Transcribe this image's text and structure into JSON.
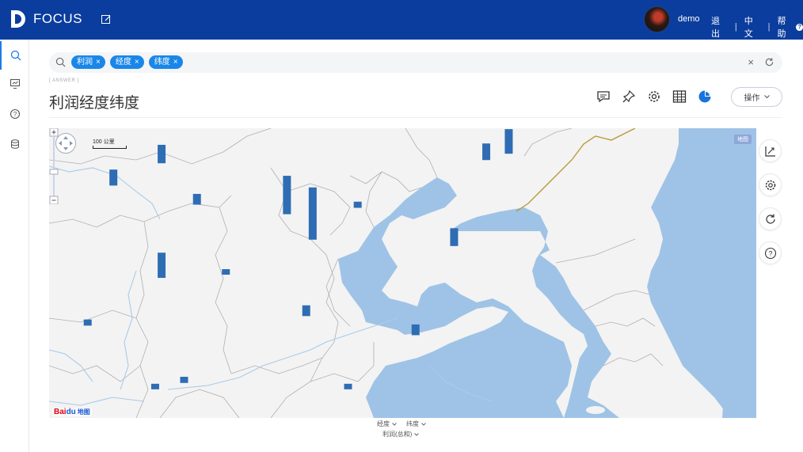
{
  "header": {
    "logo_text": "FOCUS",
    "user": "demo",
    "links": [
      "退出",
      "中文",
      "帮助"
    ]
  },
  "search": {
    "tags": [
      "利润",
      "经度",
      "纬度"
    ],
    "tag_close": "×",
    "clear_symbol": "×"
  },
  "answer_label": "[ ANSWER ]",
  "title": "利润经度纬度",
  "toolbar": {
    "icons": [
      "comment-icon",
      "pin-icon",
      "gear-icon",
      "table-icon",
      "pie-chart-icon"
    ],
    "operate_label": "操作"
  },
  "map": {
    "scale_label": "100 公里",
    "maptype_label": "地图",
    "logo_bai": "Bai",
    "logo_du": "du",
    "logo_map": "地图",
    "land_color": "#f3f3f3",
    "sea_color": "#9fc3e6",
    "bar_color": "#2e6db4",
    "border_color": "#b0b0b0",
    "korea_border_color": "#b8962e"
  },
  "chart_data": {
    "type": "bar",
    "title": "",
    "bars": [
      {
        "lng": 111.0,
        "lat": 40.8,
        "profit": 5200
      },
      {
        "lng": 112.5,
        "lat": 41.5,
        "profit": 6000
      },
      {
        "lng": 113.6,
        "lat": 40.2,
        "profit": 3500
      },
      {
        "lng": 116.4,
        "lat": 39.9,
        "profit": 12500
      },
      {
        "lng": 117.2,
        "lat": 39.1,
        "profit": 17000
      },
      {
        "lng": 118.6,
        "lat": 40.1,
        "profit": 2000
      },
      {
        "lng": 122.6,
        "lat": 41.6,
        "profit": 5400
      },
      {
        "lng": 123.3,
        "lat": 41.8,
        "profit": 8000
      },
      {
        "lng": 121.6,
        "lat": 38.9,
        "profit": 5800
      },
      {
        "lng": 112.5,
        "lat": 37.9,
        "profit": 8200
      },
      {
        "lng": 114.5,
        "lat": 38.0,
        "profit": 1500
      },
      {
        "lng": 117.0,
        "lat": 36.7,
        "profit": 3500
      },
      {
        "lng": 120.4,
        "lat": 36.1,
        "profit": 3500
      },
      {
        "lng": 110.2,
        "lat": 36.4,
        "profit": 2000
      },
      {
        "lng": 113.2,
        "lat": 34.6,
        "profit": 2000
      },
      {
        "lng": 112.3,
        "lat": 34.4,
        "profit": 1500
      },
      {
        "lng": 118.3,
        "lat": 34.4,
        "profit": 1500
      }
    ]
  },
  "axis_controls": {
    "row1": [
      "经度",
      "纬度"
    ],
    "row2": [
      "利润(总和)"
    ]
  },
  "side_tools": [
    "axis-icon",
    "settings-icon",
    "refresh-icon",
    "help-icon"
  ]
}
